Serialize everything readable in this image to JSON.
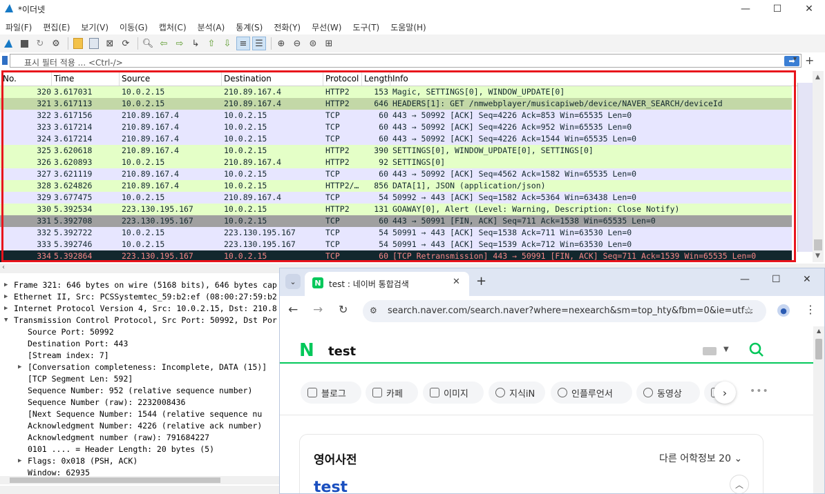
{
  "wireshark": {
    "title": "*이더넷",
    "menu": [
      "파일(F)",
      "편집(E)",
      "보기(V)",
      "이동(G)",
      "캡처(C)",
      "분석(A)",
      "통계(S)",
      "전화(Y)",
      "무선(W)",
      "도구(T)",
      "도움말(H)"
    ],
    "filter": {
      "placeholder": "표시 필터 적용 ... <Ctrl-/>"
    },
    "columns": [
      "No.",
      "Time",
      "Source",
      "Destination",
      "Protocol",
      "Length",
      "Info"
    ],
    "packets": [
      {
        "no": "320",
        "time": "3.617031",
        "src": "10.0.2.15",
        "dst": "210.89.167.4",
        "proto": "HTTP2",
        "len": "153",
        "info": "Magic, SETTINGS[0], WINDOW_UPDATE[0]",
        "bg": "#e4ffc7",
        "fg": "#12272e"
      },
      {
        "no": "321",
        "time": "3.617113",
        "src": "10.0.2.15",
        "dst": "210.89.167.4",
        "proto": "HTTP2",
        "len": "646",
        "info": "HEADERS[1]: GET /nmwebplayer/musicapiweb/device/NAVER_SEARCH/deviceId",
        "bg": "#c3d8a7",
        "fg": "#12272e"
      },
      {
        "no": "322",
        "time": "3.617156",
        "src": "210.89.167.4",
        "dst": "10.0.2.15",
        "proto": "TCP",
        "len": "60",
        "info": "443 → 50992 [ACK] Seq=4226 Ack=853 Win=65535 Len=0",
        "bg": "#e7e6ff",
        "fg": "#12272e"
      },
      {
        "no": "323",
        "time": "3.617214",
        "src": "210.89.167.4",
        "dst": "10.0.2.15",
        "proto": "TCP",
        "len": "60",
        "info": "443 → 50992 [ACK] Seq=4226 Ack=952 Win=65535 Len=0",
        "bg": "#e7e6ff",
        "fg": "#12272e"
      },
      {
        "no": "324",
        "time": "3.617214",
        "src": "210.89.167.4",
        "dst": "10.0.2.15",
        "proto": "TCP",
        "len": "60",
        "info": "443 → 50992 [ACK] Seq=4226 Ack=1544 Win=65535 Len=0",
        "bg": "#e7e6ff",
        "fg": "#12272e"
      },
      {
        "no": "325",
        "time": "3.620618",
        "src": "210.89.167.4",
        "dst": "10.0.2.15",
        "proto": "HTTP2",
        "len": "390",
        "info": "SETTINGS[0], WINDOW_UPDATE[0], SETTINGS[0]",
        "bg": "#e4ffc7",
        "fg": "#12272e"
      },
      {
        "no": "326",
        "time": "3.620893",
        "src": "10.0.2.15",
        "dst": "210.89.167.4",
        "proto": "HTTP2",
        "len": "92",
        "info": "SETTINGS[0]",
        "bg": "#e4ffc7",
        "fg": "#12272e"
      },
      {
        "no": "327",
        "time": "3.621119",
        "src": "210.89.167.4",
        "dst": "10.0.2.15",
        "proto": "TCP",
        "len": "60",
        "info": "443 → 50992 [ACK] Seq=4562 Ack=1582 Win=65535 Len=0",
        "bg": "#e7e6ff",
        "fg": "#12272e"
      },
      {
        "no": "328",
        "time": "3.624826",
        "src": "210.89.167.4",
        "dst": "10.0.2.15",
        "proto": "HTTP2/…",
        "len": "856",
        "info": "DATA[1], JSON (application/json)",
        "bg": "#e4ffc7",
        "fg": "#12272e"
      },
      {
        "no": "329",
        "time": "3.677475",
        "src": "10.0.2.15",
        "dst": "210.89.167.4",
        "proto": "TCP",
        "len": "54",
        "info": "50992 → 443 [ACK] Seq=1582 Ack=5364 Win=63438 Len=0",
        "bg": "#e7e6ff",
        "fg": "#12272e"
      },
      {
        "no": "330",
        "time": "5.392534",
        "src": "223.130.195.167",
        "dst": "10.0.2.15",
        "proto": "HTTP2",
        "len": "131",
        "info": "GOAWAY[0], Alert (Level: Warning, Description: Close Notify)",
        "bg": "#e4ffc7",
        "fg": "#12272e"
      },
      {
        "no": "331",
        "time": "5.392708",
        "src": "223.130.195.167",
        "dst": "10.0.2.15",
        "proto": "TCP",
        "len": "60",
        "info": "443 → 50991 [FIN, ACK] Seq=711 Ack=1538 Win=65535 Len=0",
        "bg": "#a0a0a0",
        "fg": "#12272e"
      },
      {
        "no": "332",
        "time": "5.392722",
        "src": "10.0.2.15",
        "dst": "223.130.195.167",
        "proto": "TCP",
        "len": "54",
        "info": "50991 → 443 [ACK] Seq=1538 Ack=711 Win=63530 Len=0",
        "bg": "#e7e6ff",
        "fg": "#12272e"
      },
      {
        "no": "333",
        "time": "5.392746",
        "src": "10.0.2.15",
        "dst": "223.130.195.167",
        "proto": "TCP",
        "len": "54",
        "info": "50991 → 443 [ACK] Seq=1539 Ack=712 Win=63530 Len=0",
        "bg": "#e7e6ff",
        "fg": "#12272e"
      },
      {
        "no": "334",
        "time": "5.392864",
        "src": "223.130.195.167",
        "dst": "10.0.2.15",
        "proto": "TCP",
        "len": "60",
        "info": "[TCP Retransmission] 443 → 50991 [FIN, ACK] Seq=711 Ack=1539 Win=65535 Len=0",
        "bg": "#12272e",
        "fg": "#f78787"
      }
    ],
    "details": [
      {
        "text": "Frame 321: 646 bytes on wire (5168 bits), 646 bytes cap",
        "indent": 0,
        "arrow": "›"
      },
      {
        "text": "Ethernet II, Src: PCSSystemtec_59:b2:ef (08:00:27:59:b2",
        "indent": 0,
        "arrow": "›"
      },
      {
        "text": "Internet Protocol Version 4, Src: 10.0.2.15, Dst: 210.8",
        "indent": 0,
        "arrow": "›"
      },
      {
        "text": "Transmission Control Protocol, Src Port: 50992, Dst Por",
        "indent": 0,
        "arrow": "⌄"
      },
      {
        "text": "Source Port: 50992",
        "indent": 1,
        "arrow": ""
      },
      {
        "text": "Destination Port: 443",
        "indent": 1,
        "arrow": ""
      },
      {
        "text": "[Stream index: 7]",
        "indent": 1,
        "arrow": ""
      },
      {
        "text": "[Conversation completeness: Incomplete, DATA (15)]",
        "indent": 1,
        "arrow": "›"
      },
      {
        "text": "[TCP Segment Len: 592]",
        "indent": 1,
        "arrow": ""
      },
      {
        "text": "Sequence Number: 952    (relative sequence number)",
        "indent": 1,
        "arrow": ""
      },
      {
        "text": "Sequence Number (raw): 2232008436",
        "indent": 1,
        "arrow": ""
      },
      {
        "text": "[Next Sequence Number: 1544    (relative sequence nu",
        "indent": 1,
        "arrow": ""
      },
      {
        "text": "Acknowledgment Number: 4226    (relative ack number)",
        "indent": 1,
        "arrow": ""
      },
      {
        "text": "Acknowledgment number (raw): 791684227",
        "indent": 1,
        "arrow": ""
      },
      {
        "text": "0101 .... = Header Length: 20 bytes (5)",
        "indent": 1,
        "arrow": ""
      },
      {
        "text": "Flags: 0x018 (PSH, ACK)",
        "indent": 1,
        "arrow": "›"
      },
      {
        "text": "Window: 62935",
        "indent": 1,
        "arrow": ""
      }
    ]
  },
  "chrome": {
    "tab_title": "test : 네이버 통합검색",
    "url": "search.naver.com/search.naver?where=nexearch&sm=top_hty&fbm=0&ie=utf…",
    "logo": "N",
    "query": "test",
    "categories": [
      "블로그",
      "카페",
      "이미지",
      "지식iN",
      "인플루언서",
      "동영상"
    ],
    "section_title": "영어사전",
    "section_more": "다른 어학정보 20",
    "result_word": "test",
    "accent": "#03c75a"
  }
}
